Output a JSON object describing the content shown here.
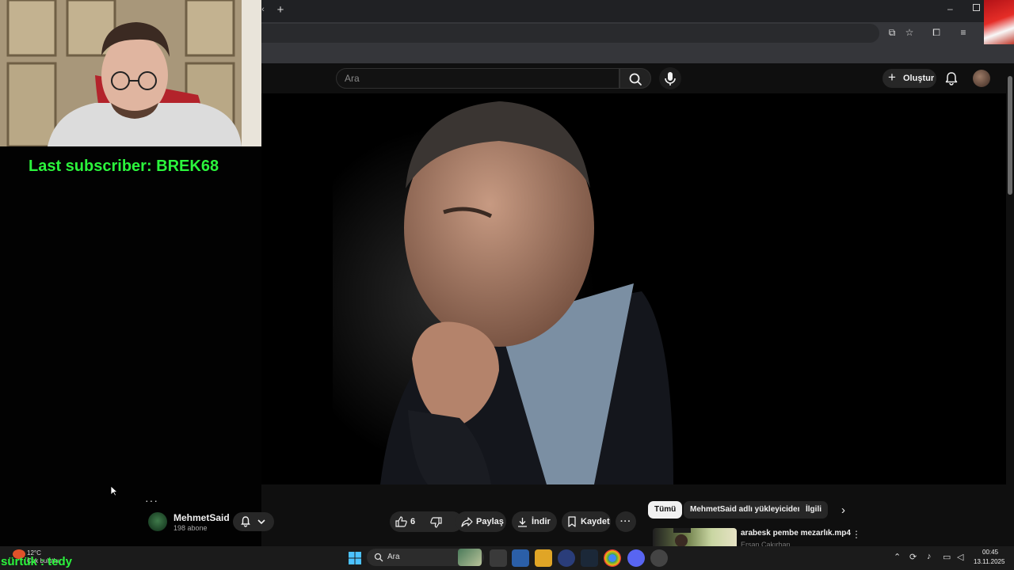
{
  "overlay": {
    "last_subscriber": "Last subscriber: BREK68",
    "chat_text": "sürtük : tedy"
  },
  "search": {
    "placeholder": "Ara"
  },
  "header": {
    "create_label": "Oluştur"
  },
  "channel": {
    "name": "MehmetSaid",
    "subscribers": "198 abone"
  },
  "actions": {
    "like_count": "6",
    "share_label": "Paylaş",
    "download_label": "İndir",
    "save_label": "Kaydet"
  },
  "chips": [
    "Tümü",
    "MehmetSaid adlı yükleyiciden",
    "İlgili"
  ],
  "recommended": {
    "title": "arabesk pembe mezarlık.mp4",
    "channel": "Ersan Çakırhan"
  },
  "taskbar": {
    "weather_temp": "12°C",
    "weather_desc": "Çok bulutlu",
    "search_label": "Ara",
    "time": "00:45",
    "date": "13.11.2025"
  },
  "colors": {
    "overlay_green": "#2bf43c",
    "youtube_dark": "#0f0f0f"
  }
}
